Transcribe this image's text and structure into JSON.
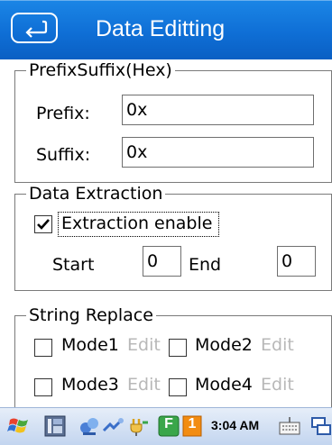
{
  "header": {
    "title": "Data Editting",
    "back_icon": "back-arrow-icon"
  },
  "prefix_suffix": {
    "legend": "PrefixSuffix(Hex)",
    "prefix_label": "Prefix:",
    "prefix_value": "0x",
    "suffix_label": "Suffix:",
    "suffix_value": "0x"
  },
  "data_extraction": {
    "legend": "Data Extraction",
    "enable_label": "Extraction enable",
    "enable_checked": true,
    "start_label": "Start",
    "start_value": "0",
    "end_label": "End",
    "end_value": "0"
  },
  "string_replace": {
    "legend": "String Replace",
    "modes": [
      {
        "label": "Mode1",
        "edit": "Edit",
        "checked": false
      },
      {
        "label": "Mode2",
        "edit": "Edit",
        "checked": false
      },
      {
        "label": "Mode3",
        "edit": "Edit",
        "checked": false
      },
      {
        "label": "Mode4",
        "edit": "Edit",
        "checked": false
      }
    ]
  },
  "taskbar": {
    "time": "3:04 AM",
    "badge_letter": "F",
    "badge_number": "1",
    "icons": [
      "start-icon",
      "desktop-icon",
      "network-icon",
      "connection-icon",
      "power-icon",
      "f-badge-icon",
      "number-badge-icon",
      "keyboard-icon",
      "window-icon"
    ]
  },
  "colors": {
    "title_bar": "#0f6fd6",
    "disabled_text": "#b8b8b8",
    "badge_green": "#3aa64a",
    "badge_orange": "#f28c12"
  }
}
